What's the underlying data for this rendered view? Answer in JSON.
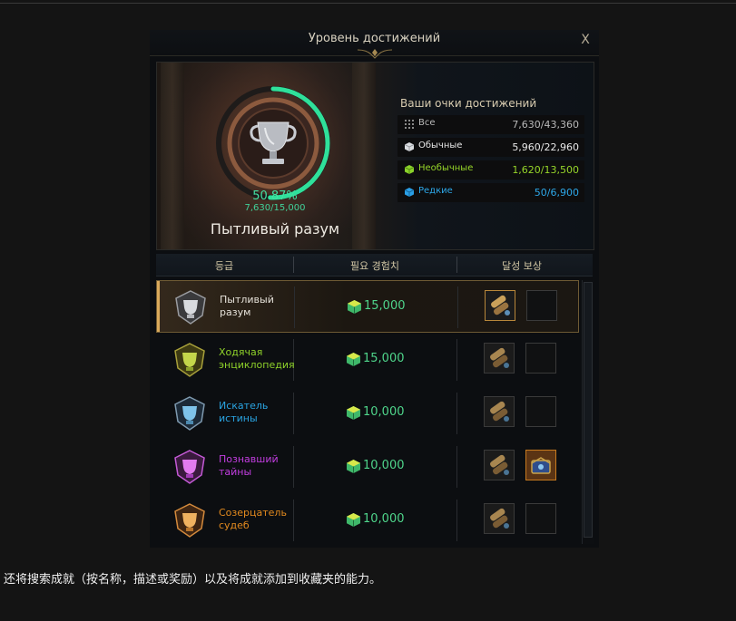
{
  "window": {
    "title": "Уровень достижений",
    "close_label": "X"
  },
  "progress": {
    "percent": "50.87%",
    "points": "7,630/15,000",
    "fraction": 0.5087,
    "current_grade": "Пытливый разум"
  },
  "scores": {
    "heading": "Ваши очки достижений",
    "rows": [
      {
        "label": "Все",
        "value": "7,630/43,360",
        "label_color": "#b9b9b9",
        "value_color": "#b9b9b9",
        "icon": "grid-icon"
      },
      {
        "label": "Обычные",
        "value": "5,960/22,960",
        "label_color": "#e8e8e8",
        "value_color": "#e8e8e8",
        "icon": "white-cube-icon"
      },
      {
        "label": "Необычные",
        "value": "1,620/13,500",
        "label_color": "#97d629",
        "value_color": "#97d629",
        "icon": "green-cube-icon"
      },
      {
        "label": "Редкие",
        "value": "50/6,900",
        "label_color": "#2da7e8",
        "value_color": "#2da7e8",
        "icon": "blue-cube-icon"
      }
    ]
  },
  "table": {
    "headers": [
      "등급",
      "필요 경험치",
      "달성 보상"
    ],
    "rows": [
      {
        "name": "Пытливый разум",
        "xp": "15,000",
        "color": "#e6e2da",
        "badge": "silver-trophy-icon",
        "reward2": "empty-slot"
      },
      {
        "name": "Ходячая энциклопедия",
        "xp": "15,000",
        "color": "#8fd22a",
        "badge": "green-trophy-icon",
        "reward2": "empty-slot"
      },
      {
        "name": "Искатель истины",
        "xp": "10,000",
        "color": "#2aa4e2",
        "badge": "blue-trophy-icon",
        "reward2": "empty-slot"
      },
      {
        "name": "Познавший тайны",
        "xp": "10,000",
        "color": "#c23de0",
        "badge": "purple-trophy-icon",
        "reward2": "treasure-box-icon"
      },
      {
        "name": "Созерцатель судеб",
        "xp": "10,000",
        "color": "#e38a1e",
        "badge": "orange-trophy-icon",
        "reward2": "empty-slot"
      }
    ]
  },
  "caption": "还将搜索成就（按名称，描述或奖励）以及将成就添加到收藏夹的能力。"
}
